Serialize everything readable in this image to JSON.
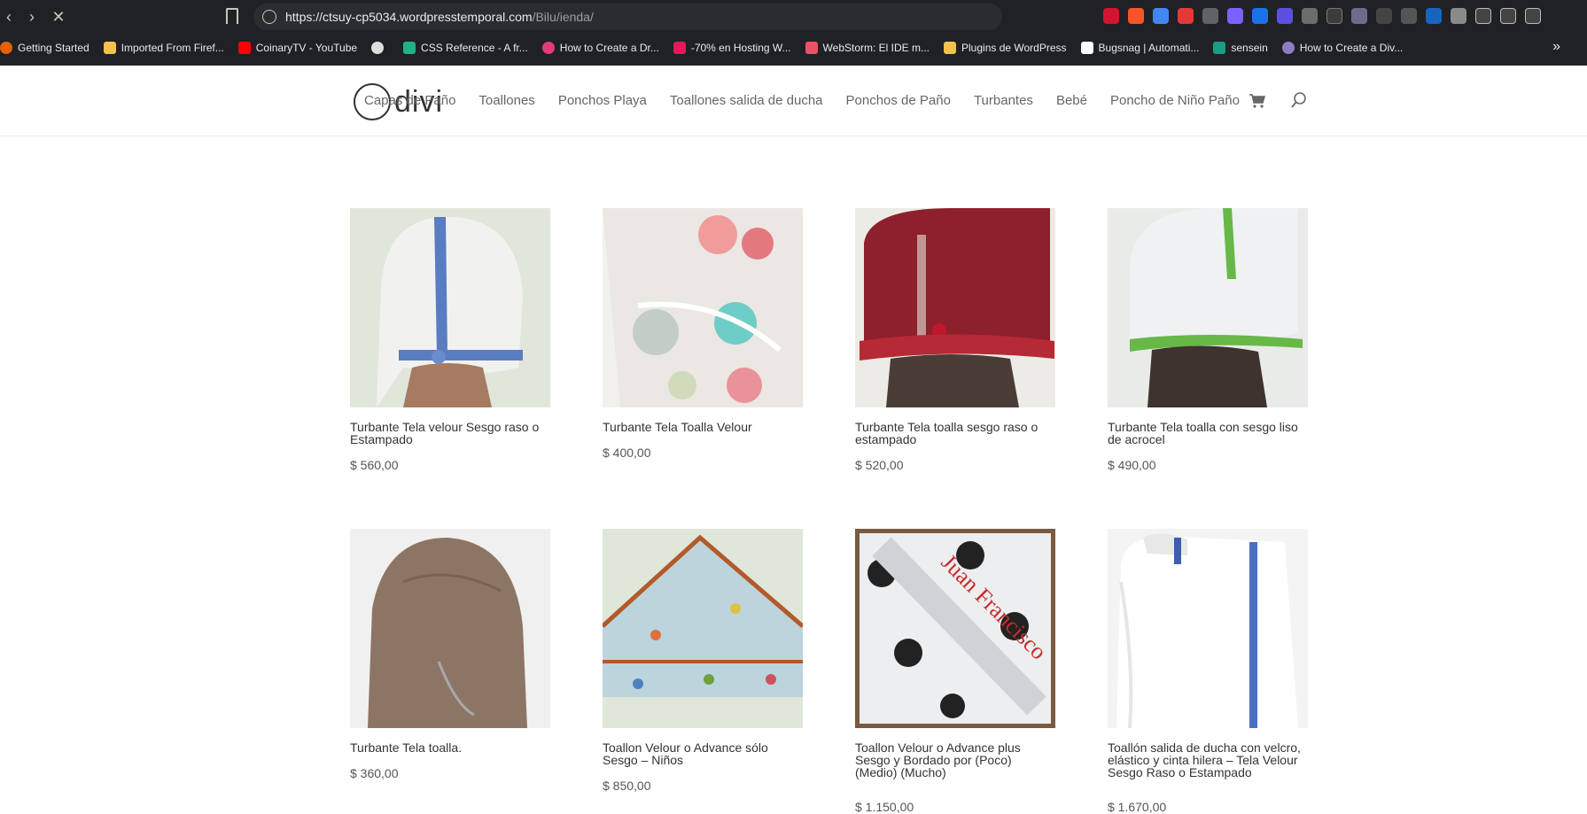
{
  "browser": {
    "url_host": "https://ctsuy-cp5034.wordpresstemporal.com",
    "url_path": "/Bilu/ienda/",
    "bookmarks": [
      {
        "label": "Getting Started",
        "color": "#e66000"
      },
      {
        "label": "Imported From Firef...",
        "color": "#f2c14e"
      },
      {
        "label": "CoinaryTV - YouTube",
        "color": "#ff0000"
      },
      {
        "label": "",
        "color": "#dddddd"
      },
      {
        "label": "CSS Reference - A fr...",
        "color": "#1fb18a"
      },
      {
        "label": "How to Create a Dr...",
        "color": "#e23b7b"
      },
      {
        "label": "-70% en Hosting W...",
        "color": "#e4185b"
      },
      {
        "label": "WebStorm: El IDE m...",
        "color": "#f04f6a"
      },
      {
        "label": "Plugins de WordPress",
        "color": "#f2c14e"
      },
      {
        "label": "Bugsnag | Automati...",
        "color": "#ffffff"
      },
      {
        "label": "sensein",
        "color": "#1b9c85"
      },
      {
        "label": "How to Create a Div...",
        "color": "#8e7cc3"
      }
    ],
    "more": "»"
  },
  "site": {
    "logo_text": "divi",
    "menu": [
      "Capas de Paño",
      "Toallones",
      "Ponchos Playa",
      "Toallones salida de ducha",
      "Ponchos de Paño",
      "Turbantes",
      "Bebé",
      "Poncho de Niño Paño"
    ]
  },
  "products": [
    {
      "title": "Turbante Tela velour Sesgo raso o Estampado",
      "price": "$ 560,00"
    },
    {
      "title": "Turbante Tela Toalla Velour",
      "price": "$ 400,00"
    },
    {
      "title": "Turbante Tela toalla sesgo raso o estampado",
      "price": "$ 520,00"
    },
    {
      "title": "Turbante Tela toalla con sesgo liso de acrocel",
      "price": "$ 490,00"
    },
    {
      "title": "Turbante Tela toalla.",
      "price": "$ 360,00"
    },
    {
      "title": "Toallon Velour o Advance sólo Sesgo – Niños",
      "price": "$ 850,00"
    },
    {
      "title": "Toallon Velour o Advance plus Sesgo y Bordado por (Poco) (Medio) (Mucho)",
      "price": "$ 1.150,00"
    },
    {
      "title": "Toallón salida de ducha con velcro, elástico y cinta hilera – Tela Velour Sesgo Raso o Estampado",
      "price": "$ 1.670,00"
    }
  ],
  "embroidery_text": "Juan Francisco"
}
